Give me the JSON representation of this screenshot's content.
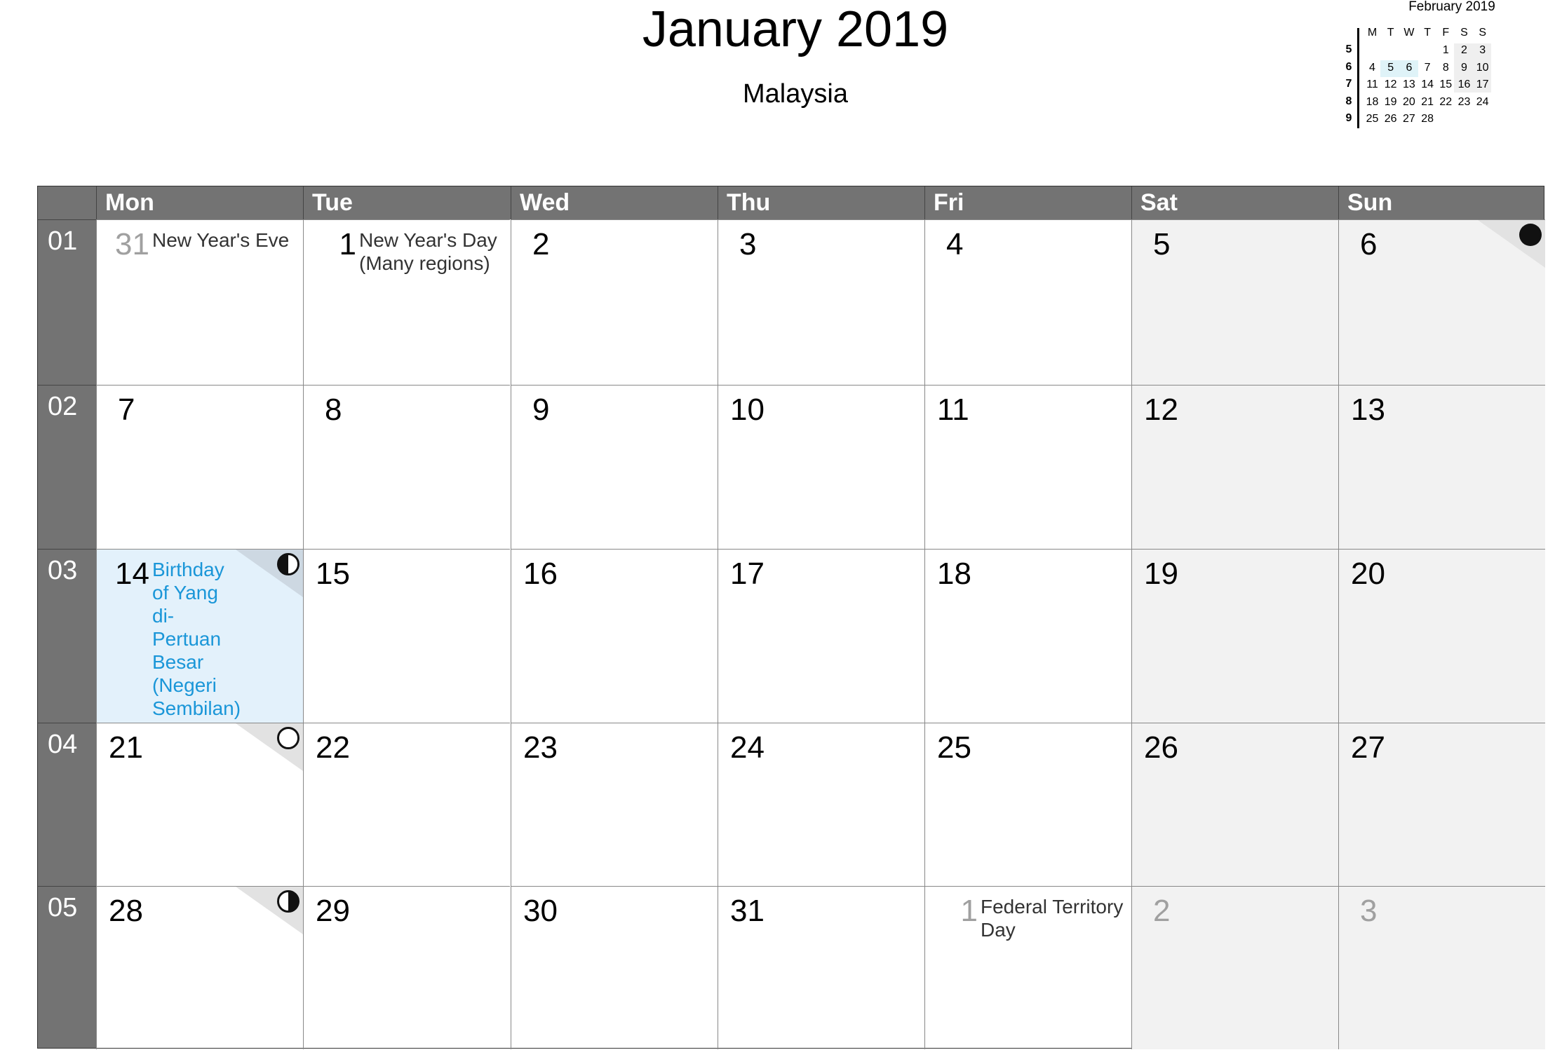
{
  "header": {
    "title": "January 2019",
    "subtitle": "Malaysia"
  },
  "mini_calendar": {
    "title": "February 2019",
    "day_headers": [
      "M",
      "T",
      "W",
      "T",
      "F",
      "S",
      "S"
    ],
    "weeks": [
      {
        "week": "5",
        "days": [
          "",
          "",
          "",
          "",
          "1",
          "2",
          "3"
        ]
      },
      {
        "week": "6",
        "days": [
          "4",
          "5",
          "6",
          "7",
          "8",
          "9",
          "10"
        ]
      },
      {
        "week": "7",
        "days": [
          "11",
          "12",
          "13",
          "14",
          "15",
          "16",
          "17"
        ]
      },
      {
        "week": "8",
        "days": [
          "18",
          "19",
          "20",
          "21",
          "22",
          "23",
          "24"
        ]
      },
      {
        "week": "9",
        "days": [
          "25",
          "26",
          "27",
          "28",
          "",
          "",
          ""
        ]
      }
    ],
    "highlighted_days": [
      "5",
      "6"
    ],
    "highlight_color": "#dff3f8",
    "weekend_color": "#efefef"
  },
  "calendar": {
    "day_headers": [
      "Mon",
      "Tue",
      "Wed",
      "Thu",
      "Fri",
      "Sat",
      "Sun"
    ],
    "colors": {
      "header_bg": "#737373",
      "weekend_bg": "#f2f2f2",
      "holiday_bg": "#e3f1fb",
      "holiday_text": "#1a96d8",
      "other_month": "#a0a0a0"
    },
    "weeks": [
      {
        "week": "01",
        "days": [
          {
            "day": "31",
            "other": true,
            "event": "New Year's Eve"
          },
          {
            "day": "1",
            "event": "New Year's Day (Many regions)"
          },
          {
            "day": "2"
          },
          {
            "day": "3"
          },
          {
            "day": "4"
          },
          {
            "day": "5"
          },
          {
            "day": "6",
            "moon": "new-moon"
          }
        ]
      },
      {
        "week": "02",
        "days": [
          {
            "day": "7"
          },
          {
            "day": "8"
          },
          {
            "day": "9"
          },
          {
            "day": "10"
          },
          {
            "day": "11"
          },
          {
            "day": "12"
          },
          {
            "day": "13"
          }
        ]
      },
      {
        "week": "03",
        "days": [
          {
            "day": "14",
            "holiday": true,
            "event": "Birthday of Yang di- Pertuan Besar (Negeri Sembilan)",
            "moon": "first-quarter-moon"
          },
          {
            "day": "15"
          },
          {
            "day": "16"
          },
          {
            "day": "17"
          },
          {
            "day": "18"
          },
          {
            "day": "19"
          },
          {
            "day": "20"
          }
        ]
      },
      {
        "week": "04",
        "days": [
          {
            "day": "21",
            "moon": "full-moon"
          },
          {
            "day": "22"
          },
          {
            "day": "23"
          },
          {
            "day": "24"
          },
          {
            "day": "25"
          },
          {
            "day": "26"
          },
          {
            "day": "27"
          }
        ]
      },
      {
        "week": "05",
        "days": [
          {
            "day": "28",
            "moon": "last-quarter-moon"
          },
          {
            "day": "29"
          },
          {
            "day": "30"
          },
          {
            "day": "31"
          },
          {
            "day": "1",
            "other": true,
            "event": "Federal Territory Day"
          },
          {
            "day": "2",
            "other": true
          },
          {
            "day": "3",
            "other": true
          }
        ]
      }
    ]
  }
}
